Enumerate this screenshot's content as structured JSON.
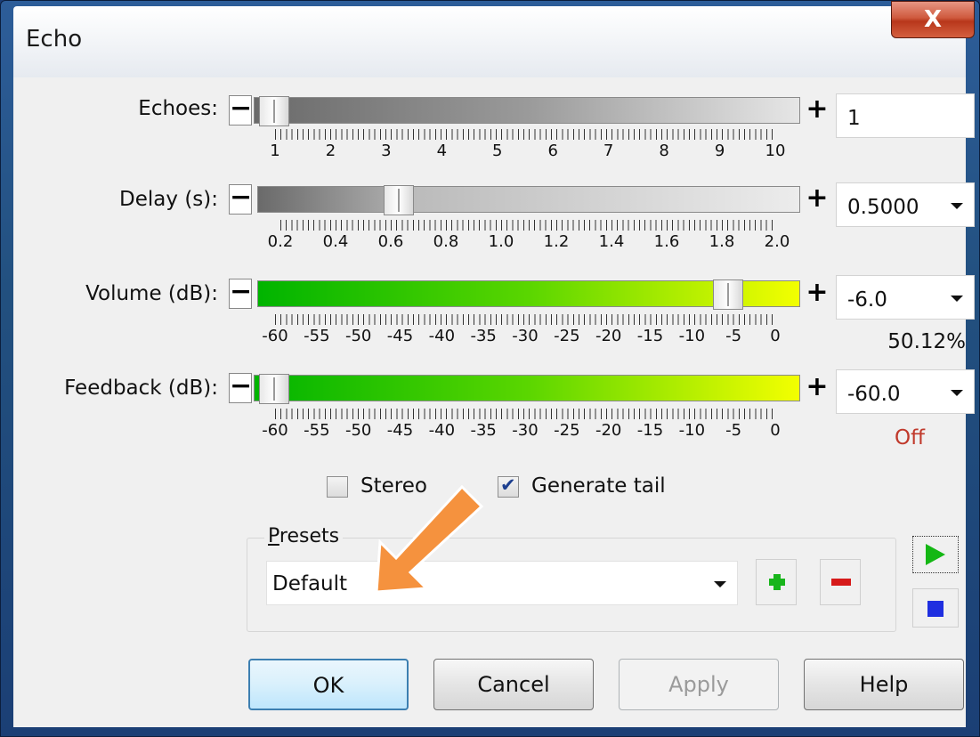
{
  "window": {
    "title": "Echo",
    "close_glyph": "X"
  },
  "sliders": {
    "echoes": {
      "label": "Echoes:",
      "value": "1",
      "position": 0.0,
      "ticks": [
        "1",
        "2",
        "3",
        "4",
        "5",
        "6",
        "7",
        "8",
        "9",
        "10"
      ]
    },
    "delay": {
      "label": "Delay (s):",
      "value": "0.5000",
      "position": 0.25,
      "ticks": [
        "0.2",
        "0.4",
        "0.6",
        "0.8",
        "1.0",
        "1.2",
        "1.4",
        "1.6",
        "1.8",
        "2.0"
      ]
    },
    "volume": {
      "label": "Volume (dB):",
      "value": "-6.0",
      "sub_value": "50.12%",
      "position": 0.9,
      "ticks": [
        "-60",
        "-55",
        "-50",
        "-45",
        "-40",
        "-35",
        "-30",
        "-25",
        "-20",
        "-15",
        "-10",
        "-5",
        "0"
      ]
    },
    "feedback": {
      "label": "Feedback (dB):",
      "value": "-60.0",
      "sub_value": "Off",
      "position": 0.0,
      "ticks": [
        "-60",
        "-55",
        "-50",
        "-45",
        "-40",
        "-35",
        "-30",
        "-25",
        "-20",
        "-15",
        "-10",
        "-5",
        "0"
      ]
    }
  },
  "options": {
    "stereo": {
      "label": "Stereo",
      "checked": false
    },
    "generate_tail": {
      "label": "Generate tail",
      "checked": true
    }
  },
  "presets": {
    "title_first": "P",
    "title_rest": "resets",
    "selected": "Default"
  },
  "buttons": {
    "ok": "OK",
    "cancel": "Cancel",
    "apply": "Apply",
    "help": "Help"
  },
  "colors": {
    "off_text": "#c0392b",
    "annotation_arrow": "#f5923e"
  }
}
